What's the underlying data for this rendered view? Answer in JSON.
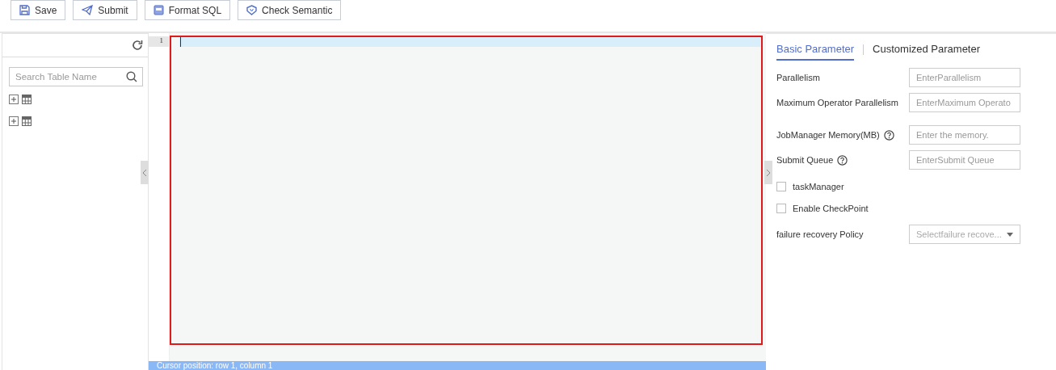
{
  "toolbar": [
    {
      "kind": "save",
      "label": "Save"
    },
    {
      "kind": "submit",
      "label": "Submit"
    },
    {
      "kind": "format",
      "label": "Format SQL"
    },
    {
      "kind": "check",
      "label": "Check Semantic"
    }
  ],
  "sidebar": {
    "search": {
      "placeholder": "Search Table Name"
    },
    "tables": [
      {
        "expanded": false
      },
      {
        "expanded": false
      }
    ]
  },
  "editor": {
    "line_numbers": [
      "1"
    ],
    "status": "Cursor position: row 1, column 1"
  },
  "tabs": [
    {
      "label": "Basic Parameter",
      "selected": true
    },
    {
      "label": "Customized Parameter",
      "selected": false
    }
  ],
  "params": [
    {
      "kind": "input",
      "label": "Parallelism",
      "help": false,
      "placeholder": "EnterParallelism"
    },
    {
      "kind": "input",
      "label": "Maximum Operator Parallelism",
      "help": false,
      "placeholder": "EnterMaximum Operato"
    },
    {
      "kind": "input",
      "label": "JobManager Memory(MB)",
      "help": true,
      "placeholder": "Enter the memory."
    },
    {
      "kind": "input",
      "label": "Submit Queue",
      "help": true,
      "placeholder": "EnterSubmit Queue"
    },
    {
      "kind": "checkbox",
      "label": "taskManager",
      "checked": false
    },
    {
      "kind": "checkbox",
      "label": "Enable CheckPoint",
      "checked": false
    },
    {
      "kind": "select",
      "label": "failure recovery Policy",
      "help": false,
      "placeholder": "Selectfailure recove..."
    }
  ]
}
